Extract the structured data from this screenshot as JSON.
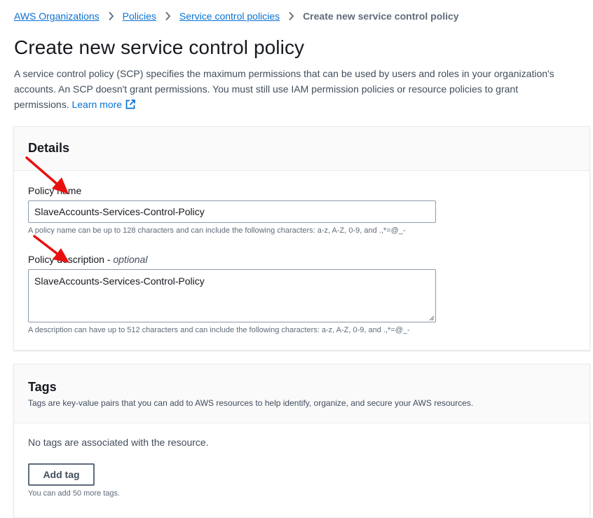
{
  "breadcrumb": {
    "items": [
      "AWS Organizations",
      "Policies",
      "Service control policies"
    ],
    "current": "Create new service control policy"
  },
  "page": {
    "title": "Create new service control policy",
    "description": "A service control policy (SCP) specifies the maximum permissions that can be used by users and roles in your organization's accounts. An SCP doesn't grant permissions. You must still use IAM permission policies or resource policies to grant permissions.",
    "learn_more": "Learn more"
  },
  "details": {
    "title": "Details",
    "name_label": "Policy name",
    "name_value": "SlaveAccounts-Services-Control-Policy",
    "name_hint": "A policy name can be up to 128 characters and can include the following characters: a-z, A-Z, 0-9, and .,*=@_-",
    "description_label": "Policy description - ",
    "description_optional": "optional",
    "description_value": "SlaveAccounts-Services-Control-Policy",
    "description_hint": "A description can have up to 512 characters and can include the following characters: a-z, A-Z, 0-9, and .,*=@_-"
  },
  "tags": {
    "title": "Tags",
    "description": "Tags are key-value pairs that you can add to AWS resources to help identify, organize, and secure your AWS resources.",
    "empty_text": "No tags are associated with the resource.",
    "add_button": "Add tag",
    "limit_text": "You can add 50 more tags."
  },
  "icons": {
    "breadcrumb_separator": "chevron-right-icon",
    "learn_more": "external-link-icon",
    "annotation": "red-arrow-icon"
  },
  "colors": {
    "link": "#0972d3",
    "annotation_arrow": "#e8100f",
    "heading": "#16191f",
    "muted": "#5f6b7a"
  }
}
